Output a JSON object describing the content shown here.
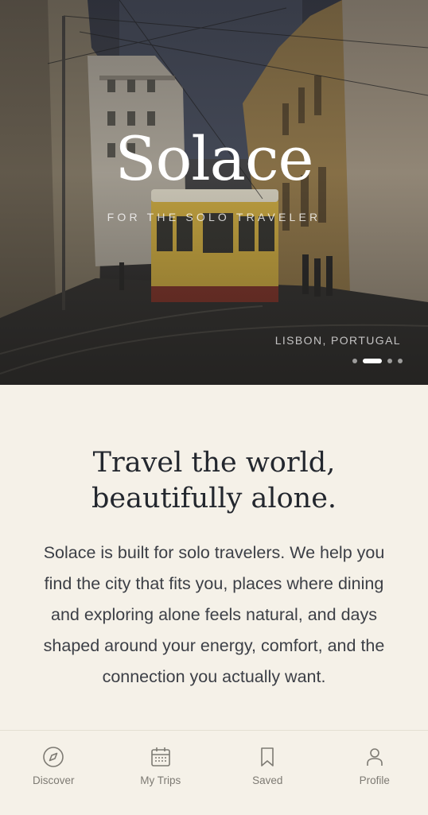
{
  "hero": {
    "brand": "Solace",
    "tagline": "FOR THE SOLO TRAVELER",
    "location": "LISBON, PORTUGAL",
    "carousel": {
      "slide_count": 4,
      "active_index": 1
    }
  },
  "intro": {
    "headline_line1": "Travel the world,",
    "headline_line2": "beautifully alone.",
    "body": "Solace is built for solo travelers. We help you find the city that fits you, places where dining and exploring alone feels natural, and days shaped around your energy, comfort, and the connection you actually want."
  },
  "tabbar": {
    "items": [
      {
        "label": "Discover",
        "icon": "compass-icon"
      },
      {
        "label": "My Trips",
        "icon": "calendar-icon"
      },
      {
        "label": "Saved",
        "icon": "bookmark-icon"
      },
      {
        "label": "Profile",
        "icon": "person-icon"
      }
    ]
  },
  "colors": {
    "background": "#f5f1e8",
    "heading": "#23272e",
    "body_text": "#3c3f46",
    "tab_inactive": "#7d7a73",
    "tram_yellow": "#d9b545"
  }
}
